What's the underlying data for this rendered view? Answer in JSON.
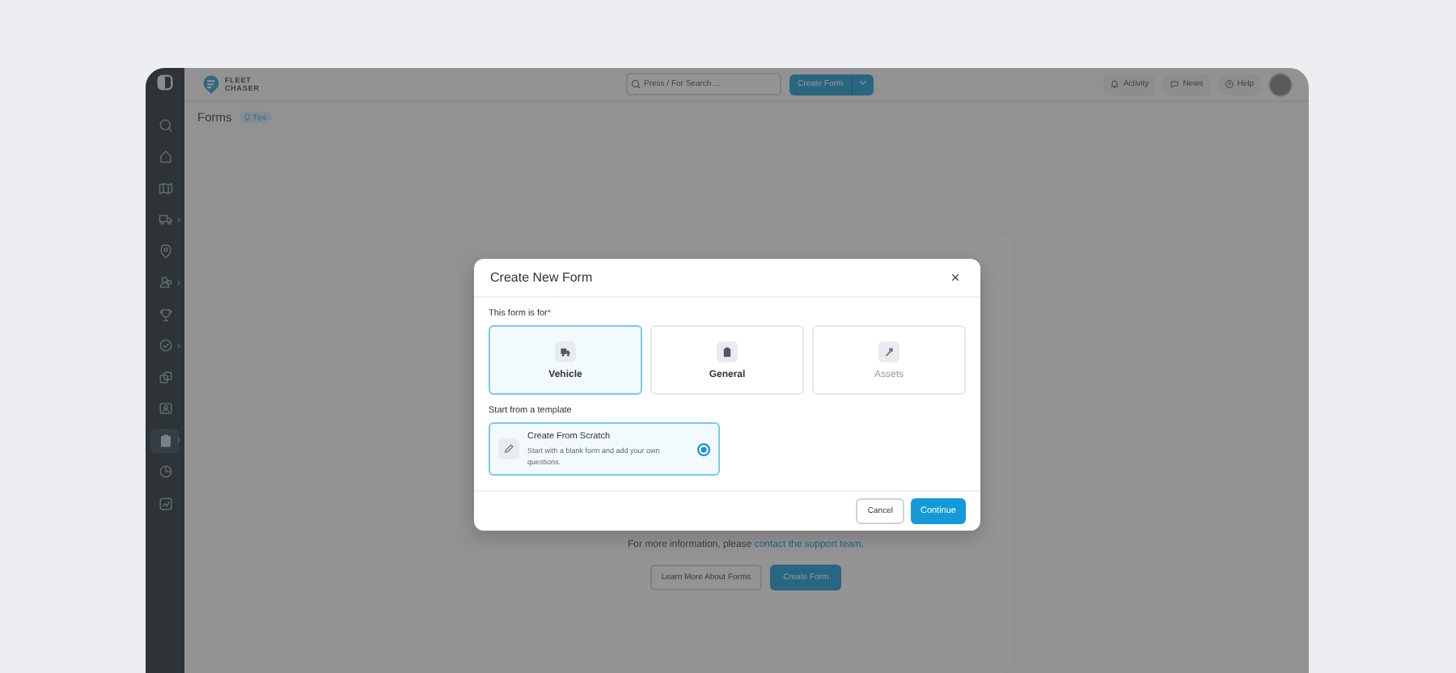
{
  "sidebar": {
    "items": [
      {
        "kind": "search",
        "selected": false,
        "expandable": false
      },
      {
        "kind": "home",
        "selected": false,
        "expandable": false
      },
      {
        "kind": "map",
        "selected": false,
        "expandable": false
      },
      {
        "kind": "truck",
        "selected": false,
        "expandable": true
      },
      {
        "kind": "pin",
        "selected": false,
        "expandable": false
      },
      {
        "kind": "users",
        "selected": false,
        "expandable": true
      },
      {
        "kind": "trophy",
        "selected": false,
        "expandable": false
      },
      {
        "kind": "check",
        "selected": false,
        "expandable": true
      },
      {
        "kind": "copy",
        "selected": false,
        "expandable": false
      },
      {
        "kind": "card",
        "selected": false,
        "expandable": false
      },
      {
        "kind": "clipboard",
        "selected": true,
        "expandable": true
      },
      {
        "kind": "pie",
        "selected": false,
        "expandable": false
      },
      {
        "kind": "chart",
        "selected": false,
        "expandable": false
      }
    ]
  },
  "header": {
    "logo": [
      "FLEET",
      "CHASER"
    ],
    "search": {
      "placeholder": "Press / For Search ..."
    },
    "create_button": "Create Form",
    "links": [
      "Activity",
      "News",
      "Help"
    ]
  },
  "page": {
    "title": "Forms",
    "tips_badge": "Tips",
    "info_text": "For more information, please ",
    "info_link": "contact the support team.",
    "buttons": [
      "Learn More About Forms",
      "Create Form"
    ]
  },
  "modal": {
    "title": "Create New Form",
    "for_label": "This form is for",
    "required_mark": "*",
    "options": [
      {
        "label": "Vehicle",
        "kind": "vehicle",
        "selected": true,
        "disabled": false
      },
      {
        "label": "General",
        "kind": "general",
        "selected": false,
        "disabled": false
      },
      {
        "label": "Assets",
        "kind": "assets",
        "selected": false,
        "disabled": true
      }
    ],
    "template_label": "Start from a template",
    "templates": [
      {
        "title": "Create From Scratch",
        "description": "Start with a blank form and add your own questions.",
        "selected": true
      }
    ],
    "cancel": "Cancel",
    "continue": "Continue"
  }
}
